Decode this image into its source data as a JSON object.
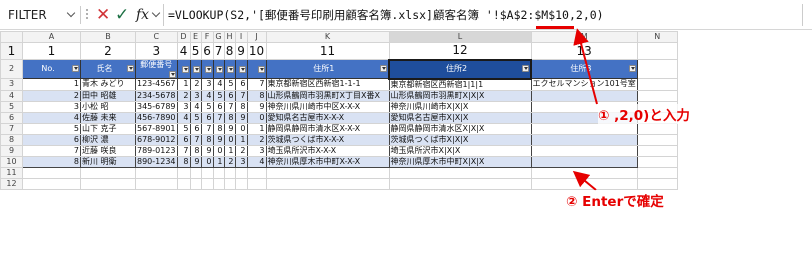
{
  "formula_bar": {
    "name_box": "FILTER",
    "formula": "=VLOOKUP(S2,'[郵便番号印刷用顧客名簿.xlsx]顧客名簿 '!$A$2:$M$10,2,0)"
  },
  "columns": [
    "A",
    "B",
    "C",
    "D",
    "E",
    "F",
    "G",
    "H",
    "I",
    "J",
    "K",
    "L",
    "M",
    "N"
  ],
  "rows": [
    "1",
    "2",
    "3",
    "4",
    "5",
    "6",
    "7",
    "8",
    "9",
    "10",
    "11",
    "12"
  ],
  "numbers_row": [
    "1",
    "2",
    "3",
    "4",
    "5",
    "6",
    "7",
    "8",
    "9",
    "10",
    "11",
    "12",
    "13"
  ],
  "headers": [
    "No.",
    "氏名",
    "郵便番号",
    "",
    "",
    "",
    "",
    "",
    "",
    "",
    "住所1",
    "住所2",
    "住所3"
  ],
  "data": [
    [
      "1",
      "青木 みどり",
      "123-4567",
      "1",
      "2",
      "3",
      "4",
      "5",
      "6",
      "7",
      "東京都新宿区西新宿1-1-1",
      "東京都新宿区西新宿1|1|1",
      "エクセルマンション101号室"
    ],
    [
      "2",
      "田中 昭雄",
      "234-5678",
      "2",
      "3",
      "4",
      "5",
      "6",
      "7",
      "8",
      "山形県鶴岡市羽黒町X丁目X番X",
      "山形県鶴岡市羽黒町X|X|X",
      ""
    ],
    [
      "3",
      "小松 昭",
      "345-6789",
      "3",
      "4",
      "5",
      "6",
      "7",
      "8",
      "9",
      "神奈川県川崎市中区X-X-X",
      "神奈川県川崎市X|X|X",
      ""
    ],
    [
      "4",
      "佐藤 未来",
      "456-7890",
      "4",
      "5",
      "6",
      "7",
      "8",
      "9",
      "0",
      "愛知県名古屋市X-X-X",
      "愛知県名古屋市X|X|X",
      ""
    ],
    [
      "5",
      "山下 克子",
      "567-8901",
      "5",
      "6",
      "7",
      "8",
      "9",
      "0",
      "1",
      "静岡県静岡市清水区X-X-X",
      "静岡県静岡市清水区X|X|X",
      ""
    ],
    [
      "6",
      "柳沢 濃",
      "678-9012",
      "6",
      "7",
      "8",
      "9",
      "0",
      "1",
      "2",
      "茨城県つくば市X-X-X",
      "茨城県つくば市X|X|X",
      ""
    ],
    [
      "7",
      "近藤 咲良",
      "789-0123",
      "7",
      "8",
      "9",
      "0",
      "1",
      "2",
      "3",
      "埼玉県所沢市X-X-X",
      "埼玉県所沢市X|X|X",
      ""
    ],
    [
      "8",
      "新川 明衛",
      "890-1234",
      "8",
      "9",
      "0",
      "1",
      "2",
      "3",
      "4",
      "神奈川県厚木市中町X-X-X",
      "神奈川県厚木市中町X|X|X",
      ""
    ]
  ],
  "annotations": {
    "step1": "① ,2,0)と入力",
    "step2": "② Enterで確定"
  },
  "colors": {
    "table_header": "#4472c4",
    "band": "#d9e2f3",
    "annotation": "#e60000"
  }
}
